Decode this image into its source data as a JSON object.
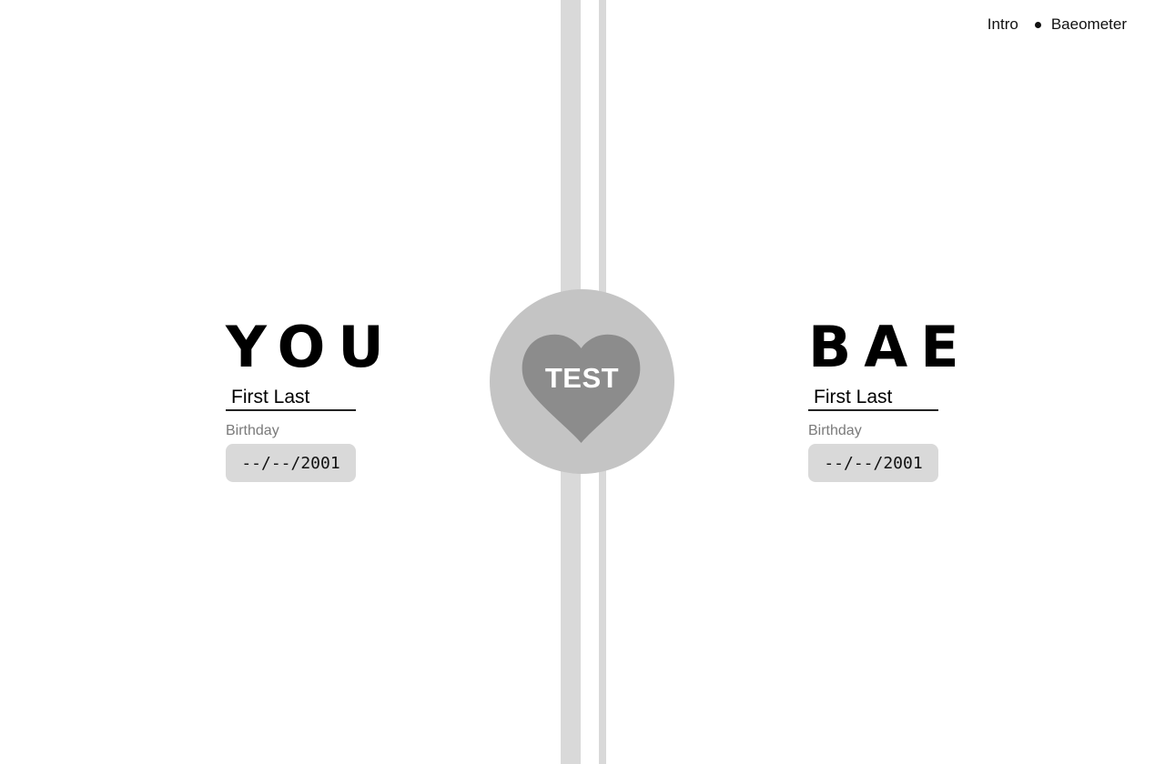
{
  "nav": {
    "items": [
      {
        "label": "Intro"
      },
      {
        "label": "Baeometer"
      }
    ]
  },
  "center": {
    "test_label": "TEST"
  },
  "you": {
    "title": "YOU",
    "name_value": "First Last",
    "birthday_label": "Birthday",
    "birthday_value": "--/--/2001"
  },
  "bae": {
    "title": "BAE",
    "name_value": "First Last",
    "birthday_label": "Birthday",
    "birthday_value": "--/--/2001"
  },
  "colors": {
    "stripe": "#d9d9d9",
    "circle": "#c4c4c4",
    "heart": "#8c8c8c",
    "date_field_bg": "#d9d9d9"
  },
  "icons": {
    "heart": "heart-icon",
    "nav_separator": "dot-separator"
  }
}
